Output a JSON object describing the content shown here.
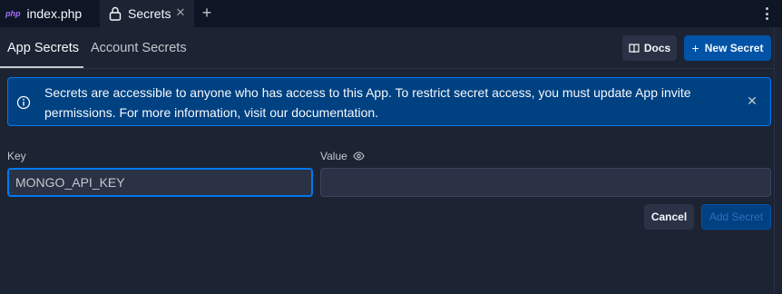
{
  "tabs": [
    {
      "icon": "php-icon",
      "icon_text": "php",
      "label": "index.php"
    },
    {
      "icon": "lock-icon",
      "label": "Secrets",
      "close": "✕"
    }
  ],
  "tab_add": "+",
  "subtabs": {
    "app": "App Secrets",
    "account": "Account Secrets"
  },
  "toolbar": {
    "docs_label": "Docs",
    "new_secret_label": "New Secret",
    "new_secret_plus": "+"
  },
  "banner": {
    "text": "Secrets are accessible to anyone who has access to this App. To restrict secret access, you must update App invite permissions. For more information, visit ",
    "link_text": "our documentation.",
    "close": "✕"
  },
  "form": {
    "key_label": "Key",
    "key_value": "MONGO_API_KEY",
    "value_label": "Value",
    "value_value": ""
  },
  "actions": {
    "cancel_label": "Cancel",
    "add_label": "Add Secret"
  },
  "colors": {
    "background": "#1c2333",
    "tabbar": "#0e1525",
    "accent": "#0079f2",
    "banner": "#004182"
  }
}
